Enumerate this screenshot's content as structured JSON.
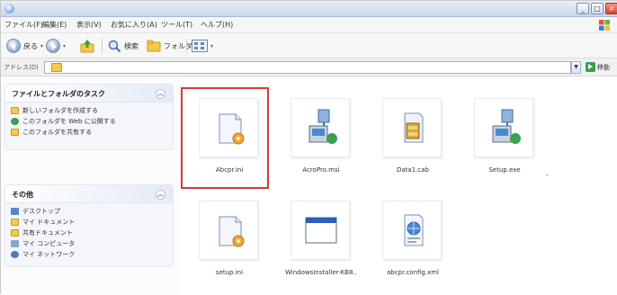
{
  "menubar": {
    "items": [
      "ファイル(F)",
      "編集(E)",
      "表示(V)",
      "お気に入り(A)",
      "ツール(T)",
      "ヘルプ(H)"
    ]
  },
  "toolbar": {
    "back_label": "戻る",
    "search_label": "検索",
    "folders_label": "フォルダ"
  },
  "address": {
    "label": "アドレス(D)",
    "go_label": "移動"
  },
  "task_pane": {
    "file_tasks": {
      "title": "ファイルとフォルダのタスク",
      "items": [
        "新しいフォルダを作成する",
        "このフォルダを Web に公開する",
        "このフォルダを共有する"
      ]
    },
    "other_places": {
      "title": "その他",
      "items": [
        "デスクトップ",
        "マイ ドキュメント",
        "共有ドキュメント",
        "マイ コンピュータ",
        "マイ ネットワーク"
      ]
    }
  },
  "files": [
    {
      "name": "Abcpr.ini",
      "icon": "ini-settings-icon"
    },
    {
      "name": "AcroPro.msi",
      "icon": "installer-msi-icon"
    },
    {
      "name": "Data1.cab",
      "icon": "cabinet-icon"
    },
    {
      "name": "Setup.exe",
      "icon": "installer-exe-icon"
    },
    {
      "name": "setup.ini",
      "icon": "ini-settings-icon"
    },
    {
      "name": "WindowsInstaller-KB8...",
      "icon": "window-app-icon"
    },
    {
      "name": "abcpr.config.xml",
      "icon": "xml-web-icon"
    }
  ],
  "stray_mark": "-",
  "colors": {
    "selection_highlight": "#d63a3a",
    "folder": "#f4c94d"
  }
}
